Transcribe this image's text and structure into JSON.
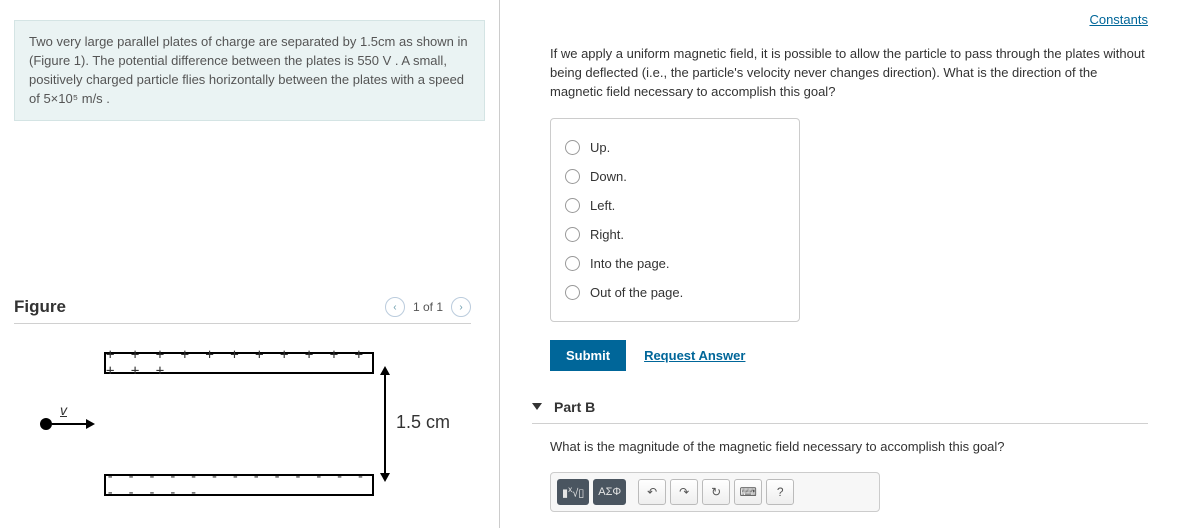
{
  "left": {
    "problem_html": "Two very large parallel plates of charge are separated by 1.5cm as shown in (Figure 1). The potential difference between the plates is 550 V . A small, positively charged particle flies horizontally between the plates with a speed of 5×10⁵ m/s .",
    "figure_title": "Figure",
    "pager": {
      "label": "1 of 1"
    },
    "diagram": {
      "top_plate": "+ + + + + + + + + + + + + +",
      "bot_plate": "- - - - - - - - - - - - - - - - - -",
      "v_label": "v",
      "dim_label": "1.5 cm"
    }
  },
  "right": {
    "constants": "Constants",
    "question": "If we apply a uniform magnetic field, it is possible to allow the particle to pass through the plates without being deflected (i.e., the particle's velocity never changes direction).  What is the direction of the magnetic field necessary to accomplish this goal?",
    "options": [
      "Up.",
      "Down.",
      "Left.",
      "Right.",
      "Into the page.",
      "Out of the page."
    ],
    "submit": "Submit",
    "request_answer": "Request Answer",
    "partB": {
      "title": "Part B",
      "prompt": "What is the magnitude of the magnetic field necessary to accomplish this goal?",
      "toolbar": {
        "templates_label": "√x",
        "greek_label": "ΑΣΦ",
        "help_label": "?"
      }
    }
  }
}
